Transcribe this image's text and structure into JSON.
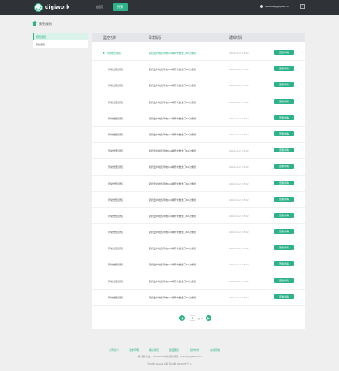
{
  "header": {
    "logo_text": "digiwork",
    "nav": [
      "首页",
      "预警"
    ],
    "user_email": "liuxu2023@qq.com.cn",
    "close_glyph": "×"
  },
  "breadcrumb": {
    "label": "预警规则"
  },
  "sidebar": {
    "items": [
      "预警通知",
      "系统通知"
    ]
  },
  "table": {
    "headers": [
      "监控名称",
      "异常情况",
      "通知时间"
    ],
    "rows": [
      {
        "name": "异常告警通知",
        "desc": "受托监护地表导电以4种异常数量了40次重要",
        "time": "2014-03-22 15:32",
        "action": "查看详情"
      },
      {
        "name": "异常告警通知",
        "desc": "受托监护地表导电以4种异常数量了40次重要",
        "time": "2014-03-22 15:32",
        "action": "查看详情"
      },
      {
        "name": "异常告警通知",
        "desc": "受托监护地表导电以4种异常数量了40次重要",
        "time": "2014-03-22 15:32",
        "action": "查看详情"
      },
      {
        "name": "异常告警通知",
        "desc": "受托监护地表导电以4种异常数量了40次重要",
        "time": "2014-03-22 15:32",
        "action": "查看详情"
      },
      {
        "name": "异常告警通知",
        "desc": "受托监护地表导电以4种异常数量了40次重要",
        "time": "2014-03-22 15:32",
        "action": "查看详情"
      },
      {
        "name": "异常告警通知",
        "desc": "受托监护地表导电以4种异常数量了40次重要",
        "time": "2014-03-22 15:32",
        "action": "查看详情"
      },
      {
        "name": "异常告警通知",
        "desc": "受托监护地表导电以4种异常数量了40次重要",
        "time": "2014-03-22 15:32",
        "action": "查看详情"
      },
      {
        "name": "异常告警通知",
        "desc": "受托监护地表导电以4种异常数量了40次重要",
        "time": "2014-03-22 15:32",
        "action": "查看详情"
      },
      {
        "name": "异常告警通知",
        "desc": "受托监护地表导电以4种异常数量了40次重要",
        "time": "2014-03-22 15:32",
        "action": "查看详情"
      },
      {
        "name": "异常告警通知",
        "desc": "受托监护地表导电以4种异常数量了40次重要",
        "time": "2014-03-22 15:32",
        "action": "查看详情"
      },
      {
        "name": "异常告警通知",
        "desc": "受托监护地表导电以4种异常数量了40次重要",
        "time": "2014-03-22 15:32",
        "action": "查看详情"
      },
      {
        "name": "异常告警通知",
        "desc": "受托监护地表导电以4种异常数量了40次重要",
        "time": "2014-03-22 15:32",
        "action": "查看详情"
      },
      {
        "name": "异常告警通知",
        "desc": "受托监护地表导电以4种异常数量了40次重要",
        "time": "2014-03-22 15:32",
        "action": "查看详情"
      },
      {
        "name": "异常告警通知",
        "desc": "受托监护地表导电以4种异常数量了40次重要",
        "time": "2014-03-22 15:32",
        "action": "查看详情"
      },
      {
        "name": "异常告警通知",
        "desc": "受托监护地表导电以4种异常数量了40次重要",
        "time": "2014-03-22 15:32",
        "action": "查看详情"
      },
      {
        "name": "异常告警通知",
        "desc": "受托监护地表导电以4种异常数量了40次重要",
        "time": "2014-03-22 15:32",
        "action": "查看详情"
      }
    ]
  },
  "pager": {
    "prev": "◀",
    "next": "▶",
    "current": "1",
    "total": "共 31"
  },
  "footer": {
    "links": [
      "公司简介",
      "法律声明",
      "联系我们",
      "加盟服务",
      "合作伙伴",
      "在线帮助"
    ],
    "line1": "客户服务热线：400-888-0111   客户服务邮箱：service@digiwork.com",
    "line2": "鄂ICP备 digiwork 迪森 鄂ICP备 12345678 号 - 1"
  },
  "colors": {
    "accent": "#2eb28a",
    "topbar": "#2f3338"
  }
}
